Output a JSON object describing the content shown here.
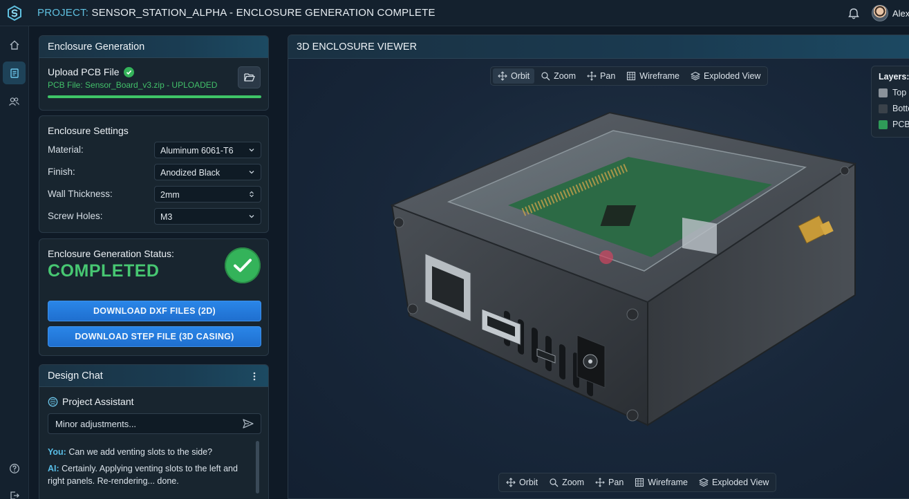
{
  "header": {
    "title_prefix": "PROJECT:",
    "title_rest": "SENSOR_STATION_ALPHA - ENCLOSURE GENERATION COMPLETE",
    "username": "Alex"
  },
  "sidebar": {
    "items": [
      {
        "icon": "home-icon"
      },
      {
        "icon": "document-icon",
        "active": true
      },
      {
        "icon": "users-icon"
      },
      {
        "icon": "help-icon"
      },
      {
        "icon": "logout-icon"
      }
    ]
  },
  "enclosure_generation": {
    "title": "Enclosure Generation",
    "upload_label": "Upload PCB File",
    "file_status": "PCB File: Sensor_Board_v3.zip - UPLOADED",
    "progress": 1.0
  },
  "settings": {
    "title": "Enclosure Settings",
    "rows": [
      {
        "label": "Material:",
        "value": "Aluminum 6061-T6",
        "control": "select"
      },
      {
        "label": "Finish:",
        "value": "Anodized Black",
        "control": "select"
      },
      {
        "label": "Wall Thickness:",
        "value": "2mm",
        "control": "stepper"
      },
      {
        "label": "Screw Holes:",
        "value": "M3",
        "control": "select"
      }
    ]
  },
  "status": {
    "label": "Enclosure Generation Status:",
    "value": "COMPLETED",
    "download_dxf": "DOWNLOAD DXF FILES (2D)",
    "download_step": "DOWNLOAD STEP FILE (3D CASING)"
  },
  "chat": {
    "title": "Design Chat",
    "assistant_name": "Project Assistant",
    "input_value": "Minor adjustments...",
    "messages": [
      {
        "who": "You:",
        "text": "Can we add venting slots to the side?"
      },
      {
        "who": "AI:",
        "text": "Certainly. Applying venting slots to the left and right panels. Re-rendering... done."
      }
    ]
  },
  "viewer": {
    "title": "3D ENCLOSURE VIEWER",
    "tools": [
      "Orbit",
      "Zoom",
      "Pan",
      "Wireframe",
      "Exploded View"
    ],
    "active_tool": "Orbit",
    "layers_title": "Layers:",
    "layers": [
      {
        "label": "Top C",
        "color": "#8a929a"
      },
      {
        "label": "Botto",
        "color": "#3a424a"
      },
      {
        "label": "PCB",
        "color": "#2f9a58"
      }
    ]
  },
  "colors": {
    "accent": "#5fc0e0",
    "success": "#47c772",
    "primary_button": "#2a86e8"
  }
}
